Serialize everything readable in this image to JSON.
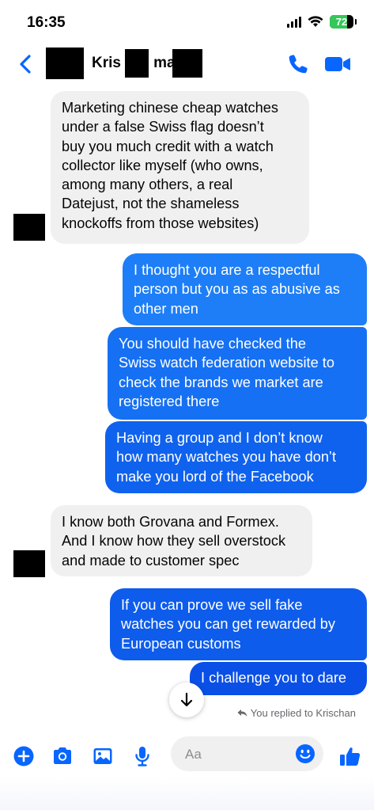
{
  "status": {
    "time": "16:35",
    "battery": "72",
    "battery_level": 0.72
  },
  "header": {
    "contact_name": "Kris     n B      mann",
    "icons": [
      "back-chevron-icon",
      "phone-icon",
      "video-camera-icon"
    ]
  },
  "colors": {
    "accent": "#0866ff",
    "incoming_bg": "#f0f0f0",
    "outgoing_top": "#1d7ef7",
    "outgoing_bottom": "#0a4fe6"
  },
  "messages": [
    {
      "side": "in",
      "lines": [
        "Marketing chinese cheap watches",
        "under a false Swiss flag doesn’t",
        "buy you much credit with a watch",
        "collector like myself (who owns,",
        "among many others, a real",
        "Datejust, not the shameless",
        "knockoffs from those websites)"
      ]
    },
    {
      "side": "out",
      "lines": [
        "I thought you are a respectful",
        "person but you as as abusive as",
        "other men"
      ]
    },
    {
      "side": "out",
      "lines": [
        "You should have checked the",
        "Swiss watch federation website to",
        "check the brands we market are",
        "registered there"
      ]
    },
    {
      "side": "out",
      "lines": [
        "Having a group and I don’t know",
        "how many watches you have don’t",
        "make you lord of the Facebook"
      ]
    },
    {
      "side": "in",
      "lines": [
        "I know both Grovana and Formex.",
        "And I know how they sell overstock",
        "and made to customer spec"
      ]
    },
    {
      "side": "out",
      "lines": [
        "If you can prove we sell fake",
        "watches you can get rewarded by",
        "European customs"
      ]
    },
    {
      "side": "out",
      "lines": [
        "I challenge you to dare"
      ]
    }
  ],
  "reply_note": "You replied to Krischan",
  "composer": {
    "placeholder": "Aa",
    "icons": [
      "plus-icon",
      "camera-icon",
      "gallery-icon",
      "microphone-icon",
      "emoji-icon",
      "thumbs-up-icon"
    ]
  }
}
